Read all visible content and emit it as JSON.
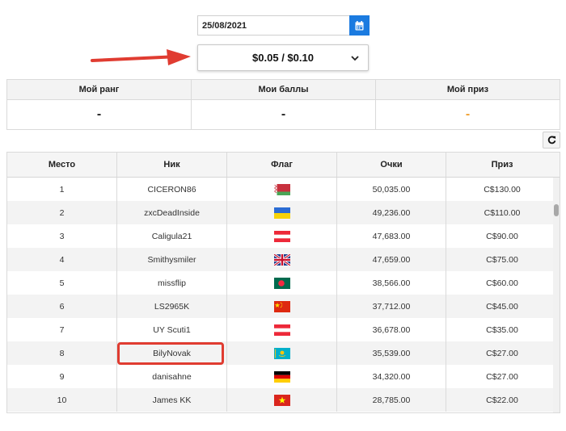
{
  "date_picker": {
    "value": "25/08/2021",
    "icon": "calendar-icon",
    "accent": "#1b7be0"
  },
  "stakes_select": {
    "value": "$0.05 / $0.10",
    "icon": "chevron-down-icon"
  },
  "annotation": {
    "arrow_color": "#e03c31",
    "highlight_color": "#e03c31",
    "highlighted_row_nick": "BilyNovak"
  },
  "stats": {
    "rank_label": "Мой ранг",
    "rank_value": "-",
    "points_label": "Мои баллы",
    "points_value": "-",
    "prize_label": "Мой приз",
    "prize_value": "-",
    "prize_color": "#f0a030"
  },
  "refresh_icon": "refresh-icon",
  "table": {
    "headers": [
      "Место",
      "Ник",
      "Флаг",
      "Очки",
      "Приз"
    ],
    "rows": [
      {
        "place": "1",
        "nick": "CICERON86",
        "flag": "belarus",
        "points": "50,035.00",
        "prize": "C$130.00"
      },
      {
        "place": "2",
        "nick": "zxcDeadInside",
        "flag": "ukraine",
        "points": "49,236.00",
        "prize": "C$110.00"
      },
      {
        "place": "3",
        "nick": "Caligula21",
        "flag": "austria",
        "points": "47,683.00",
        "prize": "C$90.00"
      },
      {
        "place": "4",
        "nick": "Smithysmiler",
        "flag": "united-kingdom",
        "points": "47,659.00",
        "prize": "C$75.00"
      },
      {
        "place": "5",
        "nick": "missflip",
        "flag": "bangladesh",
        "points": "38,566.00",
        "prize": "C$60.00"
      },
      {
        "place": "6",
        "nick": "LS2965K",
        "flag": "china",
        "points": "37,712.00",
        "prize": "C$45.00"
      },
      {
        "place": "7",
        "nick": "UY Scuti1",
        "flag": "austria",
        "points": "36,678.00",
        "prize": "C$35.00"
      },
      {
        "place": "8",
        "nick": "BilyNovak",
        "flag": "kazakhstan",
        "points": "35,539.00",
        "prize": "C$27.00"
      },
      {
        "place": "9",
        "nick": "danisahne",
        "flag": "germany",
        "points": "34,320.00",
        "prize": "C$27.00"
      },
      {
        "place": "10",
        "nick": "James KK",
        "flag": "vietnam",
        "points": "28,785.00",
        "prize": "C$22.00"
      }
    ]
  }
}
